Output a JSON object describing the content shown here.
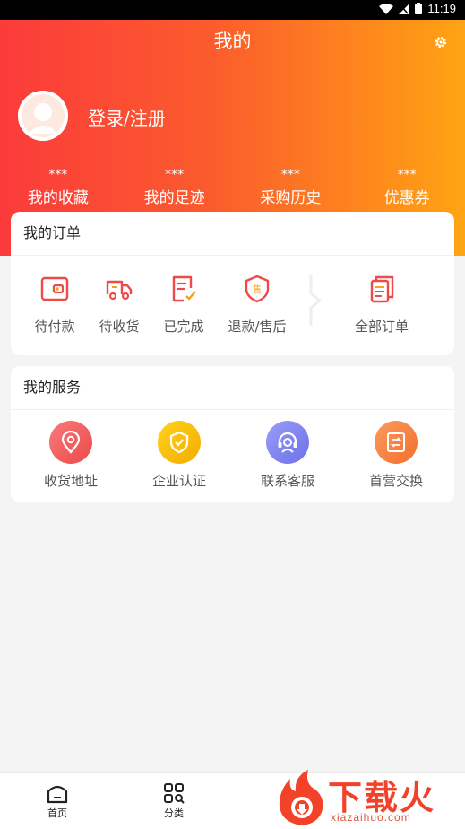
{
  "status_bar": {
    "time": "11:19"
  },
  "header": {
    "title": "我的",
    "login_label": "登录/注册",
    "gear_icon": "gear-icon"
  },
  "stats": [
    {
      "value": "***",
      "label": "我的收藏"
    },
    {
      "value": "***",
      "label": "我的足迹"
    },
    {
      "value": "***",
      "label": "采购历史"
    },
    {
      "value": "***",
      "label": "优惠券"
    }
  ],
  "orders": {
    "title": "我的订单",
    "items": [
      {
        "label": "待付款",
        "icon": "wallet-icon"
      },
      {
        "label": "待收货",
        "icon": "truck-icon"
      },
      {
        "label": "已完成",
        "icon": "checklist-icon"
      },
      {
        "label": "退款/售后",
        "icon": "shield-sale-icon"
      },
      {
        "label": "全部订单",
        "icon": "documents-icon"
      }
    ]
  },
  "services": {
    "title": "我的服务",
    "items": [
      {
        "label": "收货地址",
        "icon": "location-pin-icon",
        "color": "#f15a5a"
      },
      {
        "label": "企业认证",
        "icon": "shield-check-icon",
        "color": "#f7b500"
      },
      {
        "label": "联系客服",
        "icon": "headset-icon",
        "color": "#7a7ef0"
      },
      {
        "label": "首营交换",
        "icon": "exchange-doc-icon",
        "color": "#f57a3a"
      }
    ]
  },
  "tabbar": {
    "items": [
      {
        "label": "首页",
        "icon": "home-icon"
      },
      {
        "label": "分类",
        "icon": "category-grid-icon"
      }
    ]
  },
  "watermark": {
    "brand": "下载火",
    "url": "xiazaihuo.com"
  },
  "colors": {
    "header_start": "#fb3b3b",
    "header_end": "#ffa412",
    "accent": "#f15a5a"
  }
}
